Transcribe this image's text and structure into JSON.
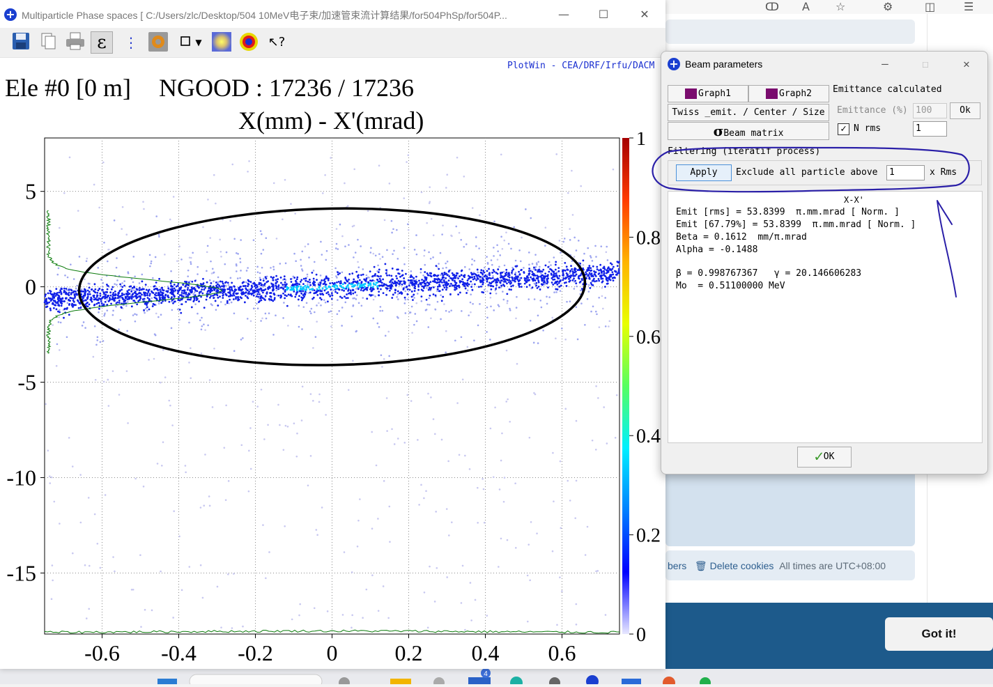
{
  "browser": {
    "footer": {
      "members_partial": "bers",
      "delete_cookies": "Delete cookies",
      "times_note": "All times are UTC+08:00"
    },
    "cookie_button": "Got it!",
    "taskbar_badge": "4"
  },
  "plotwin": {
    "title": "Multiparticle Phase spaces [ C:/Users/zlc/Desktop/504 10MeV电子束/加速管束流计算结果/for504PhSp/for504P...",
    "window_controls": {
      "minimize": "—",
      "maximize": "☐",
      "close": "✕"
    },
    "toolbar": {
      "icons": [
        "save-icon",
        "copy-icon",
        "print-icon",
        "epsilon-icon",
        "list-icon",
        "settings-icon",
        "square-icon",
        "dropdown-arrow-icon",
        "density-map-icon",
        "target-icon",
        "help-cursor-icon"
      ],
      "epsilon_glyph": "ε"
    },
    "credit": "PlotWin - CEA/DRF/Irfu/DACM",
    "header": {
      "element": "Ele #0 [0 m]",
      "ngood": "NGOOD : 17236 / 17236",
      "axes_title": "X(mm) - X'(mrad)"
    }
  },
  "chart_data": {
    "type": "scatter",
    "title": "X(mm) - X'(mrad)",
    "xlabel": "X (mm)",
    "ylabel": "X' (mrad)",
    "xlim": [
      -0.75,
      0.75
    ],
    "ylim": [
      -18.2,
      7.8
    ],
    "x_ticks": [
      -0.6,
      -0.4,
      -0.2,
      0,
      0.2,
      0.4,
      0.6
    ],
    "x_tick_labels": [
      "-0.6",
      "-0.4",
      "-0.2",
      "0",
      "0.2",
      "0.4",
      "0.6"
    ],
    "y_ticks": [
      5,
      0,
      -5,
      -10,
      -15
    ],
    "y_tick_labels": [
      "5",
      "0",
      "-5",
      "-10",
      "-15"
    ],
    "grid": true,
    "particles": 17236,
    "colorbar": {
      "ticks": [
        1,
        0.8,
        0.6,
        0.4,
        0.2,
        0
      ],
      "tick_labels": [
        "1",
        "0.8",
        "0.6",
        "0.4",
        "0.2",
        "0"
      ],
      "colors": [
        "#a50000",
        "#ff3b00",
        "#ffb400",
        "#e8ff00",
        "#56ff60",
        "#00f0ff",
        "#0080ff",
        "#0000ff",
        "#e8e8ff"
      ]
    },
    "core": {
      "x_range": [
        -0.75,
        0.75
      ],
      "slope_mrad_per_mm": 0.9,
      "spread_mrad": 0.3
    },
    "halo": {
      "x_range": [
        -0.75,
        0.75
      ],
      "y_range": [
        -18,
        7
      ]
    },
    "annotation_ellipse": {
      "center": [
        0.0,
        0.0
      ],
      "half_width_mm": 0.66,
      "half_height_mrad": 4.1
    }
  },
  "dialog": {
    "title": "Beam parameters",
    "window_controls": {
      "minimize": "—",
      "maximize": "☐",
      "close": "✕"
    },
    "graph1": "Graph1",
    "graph2": "Graph2",
    "twiss_label": "Twiss _emit. / Center / Size",
    "beam_matrix": "Beam matrix",
    "sigma_glyph": "σ",
    "emittance_calculated": "Emittance calculated",
    "emittance_label": "Emittance (%)",
    "emittance_value": "100",
    "ok_small": "Ok",
    "n_rms_label": "N rms",
    "n_rms_value": "1",
    "checkmark": "✓",
    "filtering_label": "Filtering (iteratif process)",
    "apply": "Apply",
    "exclude_label": "Exclude all particle above",
    "exclude_value": "1",
    "x_rms": "x Rms",
    "result_header": "X-X'",
    "results": [
      "Emit [rms] = 53.8399  π.mm.mrad [ Norm. ]",
      "Emit [67.79%] = 53.8399  π.mm.mrad [ Norm. ]",
      "Beta = 0.1612  mm/π.mrad",
      "Alpha = -0.1488",
      "",
      "β = 0.998767367   γ = 20.146606283",
      "Mo  = 0.51100000 MeV"
    ],
    "ok_button": "OK"
  },
  "annotation_ink": {
    "color": "#2a1fa8"
  }
}
